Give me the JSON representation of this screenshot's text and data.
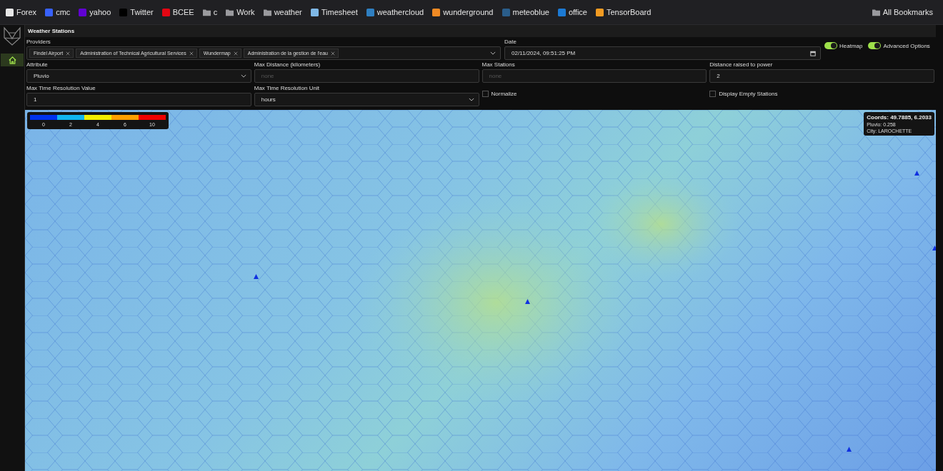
{
  "bookmarks": [
    {
      "label": "Forex",
      "kind": "site",
      "color": "#e8e8e8"
    },
    {
      "label": "cmc",
      "kind": "site",
      "color": "#3861fb"
    },
    {
      "label": "yahoo",
      "kind": "site",
      "color": "#6001d2"
    },
    {
      "label": "Twitter",
      "kind": "site",
      "color": "#000000"
    },
    {
      "label": "BCEE",
      "kind": "site",
      "color": "#e30613"
    },
    {
      "label": "c",
      "kind": "folder"
    },
    {
      "label": "Work",
      "kind": "folder"
    },
    {
      "label": "weather",
      "kind": "folder"
    },
    {
      "label": "Timesheet",
      "kind": "site",
      "color": "#7fb8e6"
    },
    {
      "label": "weathercloud",
      "kind": "site",
      "color": "#2f7fc1"
    },
    {
      "label": "wunderground",
      "kind": "site",
      "color": "#f08a24"
    },
    {
      "label": "meteoblue",
      "kind": "site",
      "color": "#2a5d8a"
    },
    {
      "label": "office",
      "kind": "site",
      "color": "#1c7ad4"
    },
    {
      "label": "TensorBoard",
      "kind": "site",
      "color": "#f29b22"
    }
  ],
  "all_bookmarks": "All Bookmarks",
  "sidebar": {
    "items": [
      {
        "kind": "home",
        "selected": true
      }
    ]
  },
  "title": "Weather Stations",
  "providers": {
    "label": "Providers",
    "chips": [
      "Findel Airport",
      "Administration of Technical Agricultural Services",
      "Wundermap",
      "Administration de la gestion de l'eau"
    ]
  },
  "date": {
    "label": "Date",
    "value": "02/11/2024, 09:51:25 PM"
  },
  "toggles": [
    {
      "label": "Heatmap",
      "on": true
    },
    {
      "label": "Advanced Options",
      "on": true
    }
  ],
  "fields": [
    {
      "label": "Attribute",
      "kind": "select",
      "value": "Pluvio"
    },
    {
      "label": "Max Distance (kilometers)",
      "kind": "input",
      "placeholder": "none"
    },
    {
      "label": "Max Stations",
      "kind": "input",
      "placeholder": "none"
    },
    {
      "label": "Distance raised to power",
      "kind": "input",
      "value": "2"
    },
    {
      "label": "Max Time Resolution Value",
      "kind": "input",
      "value": "1"
    },
    {
      "label": "Max Time Resolution Unit",
      "kind": "select",
      "value": "hours"
    },
    {
      "label": "Normalize",
      "kind": "checkbox",
      "checked": false
    },
    {
      "label": "Display Empty Stations",
      "kind": "checkbox",
      "checked": false
    }
  ],
  "legend": [
    {
      "label": "0",
      "color": "#0033ee"
    },
    {
      "label": "2",
      "color": "#11b5f0"
    },
    {
      "label": "4",
      "color": "#f2ee00"
    },
    {
      "label": "6",
      "color": "#ffa000"
    },
    {
      "label": "10",
      "color": "#f00000"
    }
  ],
  "tooltip": {
    "title": "Coords: 49.7885, 6.2033",
    "lines": [
      "Pluvio: 0.258",
      "City: LAROCHETTE"
    ]
  }
}
